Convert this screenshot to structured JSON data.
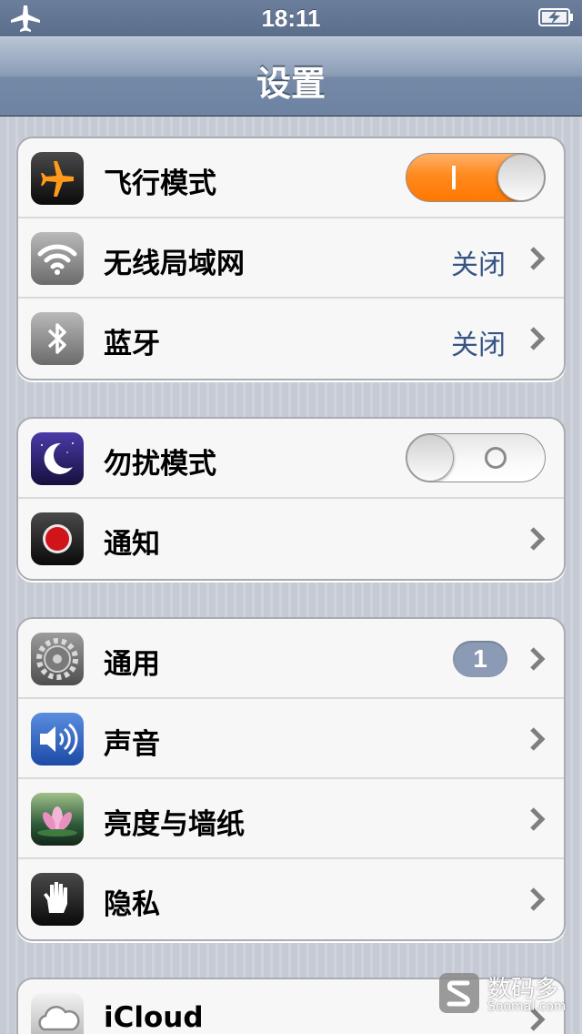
{
  "status_bar": {
    "time": "18:11",
    "left_icon": "airplane-icon",
    "right_icon": "battery-charging-icon"
  },
  "nav": {
    "title": "设置"
  },
  "groups": [
    {
      "rows": [
        {
          "label": "飞行模式",
          "icon": "airplane-icon",
          "control": "toggle",
          "toggle_on": true
        },
        {
          "label": "无线局域网",
          "icon": "wifi-icon",
          "value": "关闭"
        },
        {
          "label": "蓝牙",
          "icon": "bluetooth-icon",
          "value": "关闭"
        }
      ]
    },
    {
      "rows": [
        {
          "label": "勿扰模式",
          "icon": "moon-icon",
          "control": "toggle",
          "toggle_on": false
        },
        {
          "label": "通知",
          "icon": "notification-icon"
        }
      ]
    },
    {
      "rows": [
        {
          "label": "通用",
          "icon": "gear-icon",
          "badge": "1"
        },
        {
          "label": "声音",
          "icon": "speaker-icon"
        },
        {
          "label": "亮度与墙纸",
          "icon": "flower-icon"
        },
        {
          "label": "隐私",
          "icon": "hand-icon"
        }
      ]
    },
    {
      "rows": [
        {
          "label": "iCloud",
          "icon": "cloud-icon"
        }
      ]
    }
  ],
  "watermark": {
    "cn": "数码多",
    "en": "Soomal.com"
  },
  "colors": {
    "toggle_on": "#ff8a1f",
    "value_text": "#385487",
    "badge": "#8c9bb5",
    "nav_bar": "#7489a6"
  }
}
